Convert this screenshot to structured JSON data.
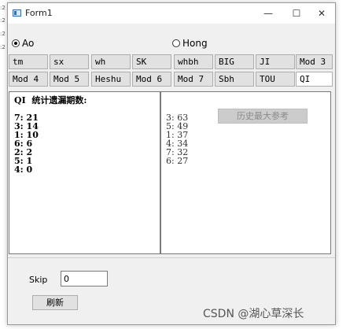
{
  "edge_fragments": [
    ":2",
    ":2",
    ":2",
    ":2"
  ],
  "window": {
    "title": "Form1",
    "minimize_glyph": "—",
    "maximize_glyph": "☐",
    "close_glyph": "✕"
  },
  "radios": [
    {
      "label": "Ao",
      "checked": true
    },
    {
      "label": "Hong",
      "checked": false
    }
  ],
  "buttons_row1": [
    "tm",
    "sx",
    "wh",
    "SK",
    "whbh",
    "BIG",
    "JI",
    "Mod 3"
  ],
  "buttons_row2": [
    "Mod 4",
    "Mod 5",
    "Heshu",
    "Mod 6",
    "Mod 7",
    "Sbh",
    "TOU",
    "QI"
  ],
  "left_panel": {
    "lines": [
      "QI  统计遗漏期数:",
      "",
      "7: 21",
      "3: 14",
      "1: 10",
      "6: 6",
      "2: 2",
      "5: 1",
      "4: 0"
    ]
  },
  "right_panel": {
    "history_button": "历史最大参考",
    "lines": [
      "3: 63",
      "5: 49",
      "1: 37",
      "4: 34",
      "7: 32",
      "6: 27"
    ]
  },
  "skip": {
    "label": "Skip",
    "value": "0"
  },
  "refresh_label": "刷新",
  "watermark": "CSDN @湖心草深长"
}
